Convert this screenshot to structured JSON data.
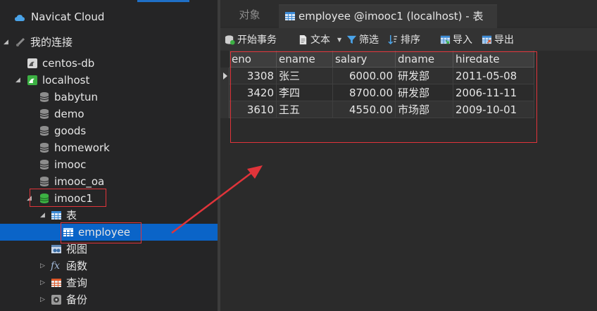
{
  "app": {
    "name": "Navicat Cloud"
  },
  "tree": {
    "my_connections": "我的连接",
    "connections": [
      {
        "label": "centos-db"
      },
      {
        "label": "localhost"
      }
    ],
    "databases": [
      "babytun",
      "demo",
      "goods",
      "homework",
      "imooc",
      "imooc_oa",
      "imooc1"
    ],
    "groups": {
      "tables": "表",
      "views": "视图",
      "functions": "函数",
      "queries": "查询",
      "backups": "备份"
    },
    "selected_table": "employee"
  },
  "tabs": {
    "objects": "对象",
    "active": "employee @imooc1 (localhost) - 表"
  },
  "toolbar": {
    "begin_transaction": "开始事务",
    "text": "文本",
    "filter": "筛选",
    "sort": "排序",
    "import": "导入",
    "export": "导出"
  },
  "table": {
    "columns": [
      "eno",
      "ename",
      "salary",
      "dname",
      "hiredate"
    ],
    "rows": [
      {
        "eno": "3308",
        "ename": "张三",
        "salary": "6000.00",
        "dname": "研发部",
        "hiredate": "2011-05-08"
      },
      {
        "eno": "3420",
        "ename": "李四",
        "salary": "8700.00",
        "dname": "研发部",
        "hiredate": "2006-11-11"
      },
      {
        "eno": "3610",
        "ename": "王五",
        "salary": "4550.00",
        "dname": "市场部",
        "hiredate": "2009-10-01"
      }
    ]
  },
  "colors": {
    "accent": "#0a64c8",
    "annotation": "#e0343a",
    "db_active": "#3cb043"
  }
}
